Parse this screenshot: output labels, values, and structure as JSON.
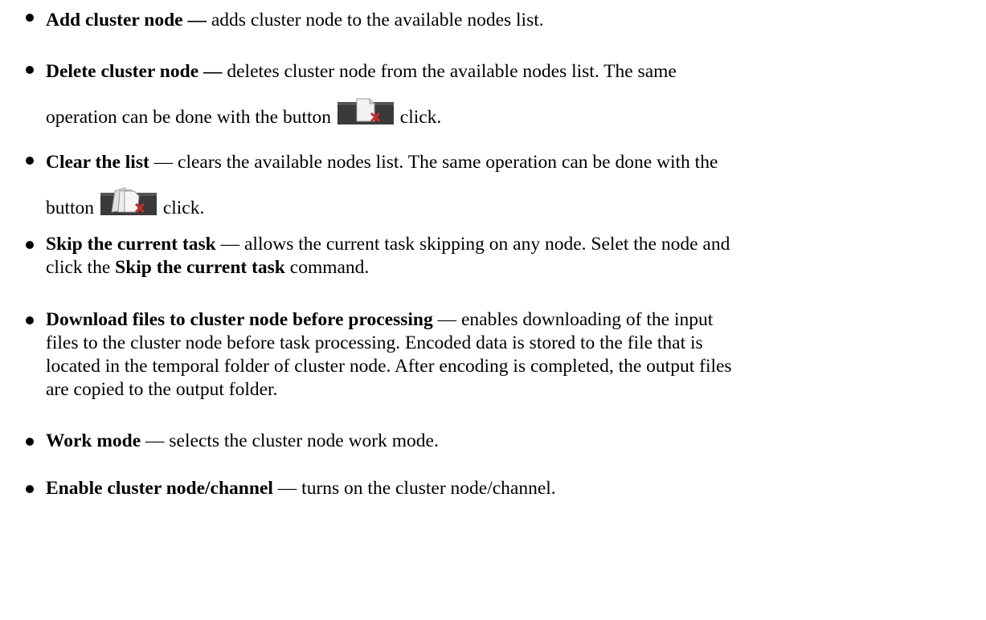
{
  "items": [
    {
      "term": "Add cluster node —",
      "desc": " adds cluster node to the available nodes list."
    },
    {
      "term": "Delete cluster node —",
      "desc": " deletes cluster node from the available nodes list. The same",
      "line2_before": "operation can be done with the button",
      "line2_after": " click.",
      "icon": "delete-node-icon"
    },
    {
      "term": "Clear the list",
      "desc": " — clears the available nodes list. The same operation can be done with the",
      "line2_before": "button",
      "line2_after": " click.",
      "icon": "clear-list-icon"
    },
    {
      "term": "Skip the current task",
      "desc": " — allows the current task skipping on any node. Selet the node and",
      "line2_before": "click the ",
      "line2_bold": "Skip the current task",
      "line2_after": " command."
    },
    {
      "term": "Download files to cluster node before processing",
      "desc": " — enables downloading of the input",
      "lines": [
        "files to the cluster node before task processing. Encoded data is stored to the file that is",
        "located in the temporal folder of cluster node. After encoding is completed, the output files",
        "are copied to the output folder."
      ]
    },
    {
      "term": "Work mode",
      "desc": " — selects the cluster node work mode."
    },
    {
      "term": "Enable cluster node/channel",
      "desc": " — turns on the cluster node/channel."
    }
  ],
  "colors": {
    "icon_bg": "#3a3a3a",
    "icon_page": "#f2f2f2",
    "icon_x": "#d42a2a"
  }
}
